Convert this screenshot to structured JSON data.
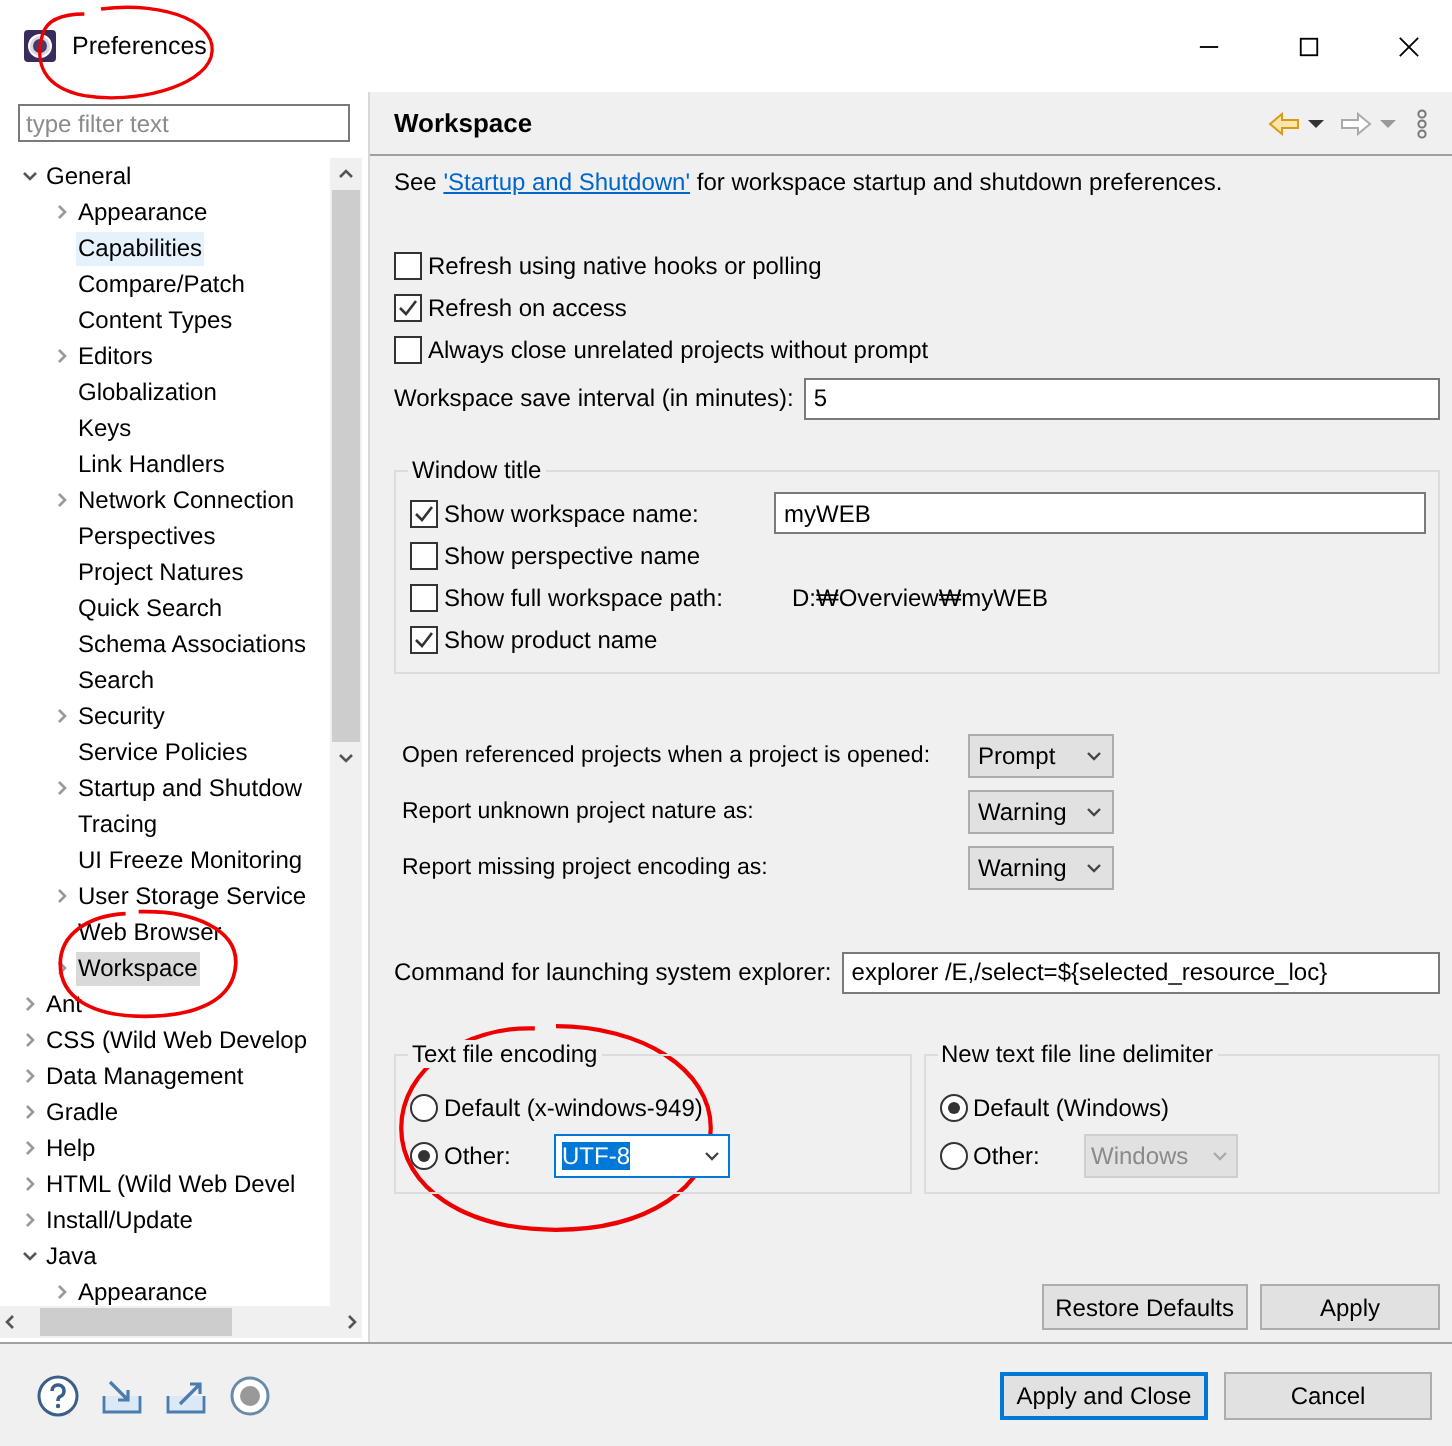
{
  "window": {
    "title": "Preferences"
  },
  "filter": {
    "placeholder": "type filter text"
  },
  "tree": [
    {
      "label": "General",
      "expanded": true,
      "selected": false,
      "children": [
        {
          "label": "Appearance",
          "expanded": false,
          "selected": false
        },
        {
          "label": "Capabilities",
          "selected": false,
          "highlighted": true
        },
        {
          "label": "Compare/Patch",
          "selected": false
        },
        {
          "label": "Content Types",
          "selected": false
        },
        {
          "label": "Editors",
          "expanded": false,
          "selected": false
        },
        {
          "label": "Globalization",
          "selected": false
        },
        {
          "label": "Keys",
          "selected": false
        },
        {
          "label": "Link Handlers",
          "selected": false
        },
        {
          "label": "Network Connection",
          "expanded": false,
          "selected": false
        },
        {
          "label": "Perspectives",
          "selected": false
        },
        {
          "label": "Project Natures",
          "selected": false
        },
        {
          "label": "Quick Search",
          "selected": false
        },
        {
          "label": "Schema Associations",
          "selected": false
        },
        {
          "label": "Search",
          "selected": false
        },
        {
          "label": "Security",
          "expanded": false,
          "selected": false
        },
        {
          "label": "Service Policies",
          "selected": false
        },
        {
          "label": "Startup and Shutdow",
          "expanded": false,
          "selected": false
        },
        {
          "label": "Tracing",
          "selected": false
        },
        {
          "label": "UI Freeze Monitoring",
          "selected": false
        },
        {
          "label": "User Storage Service",
          "expanded": false,
          "selected": false
        },
        {
          "label": "Web Browser",
          "selected": false
        },
        {
          "label": "Workspace",
          "expanded": false,
          "selected": true
        }
      ]
    },
    {
      "label": "Ant",
      "expanded": false,
      "selected": false
    },
    {
      "label": "CSS (Wild Web Develop",
      "expanded": false,
      "selected": false
    },
    {
      "label": "Data Management",
      "expanded": false,
      "selected": false
    },
    {
      "label": "Gradle",
      "expanded": false,
      "selected": false
    },
    {
      "label": "Help",
      "expanded": false,
      "selected": false
    },
    {
      "label": "HTML (Wild Web Devel",
      "expanded": false,
      "selected": false
    },
    {
      "label": "Install/Update",
      "expanded": false,
      "selected": false
    },
    {
      "label": "Java",
      "expanded": true,
      "selected": false,
      "children": [
        {
          "label": "Appearance",
          "expanded": false,
          "selected": false
        }
      ]
    }
  ],
  "page": {
    "title": "Workspace",
    "intro": {
      "before": "See ",
      "link": "'Startup and Shutdown'",
      "after": " for workspace startup and shutdown preferences."
    },
    "options": [
      {
        "label": "Refresh using native hooks or polling",
        "checked": false
      },
      {
        "label": "Refresh on access",
        "checked": true
      },
      {
        "label": "Always close unrelated projects without prompt",
        "checked": false
      }
    ],
    "save_interval": {
      "label": "Workspace save interval (in minutes):",
      "value": "5"
    },
    "window_title": {
      "legend": "Window title",
      "options": [
        {
          "kind": "field",
          "label": "Show workspace name:",
          "checked": true,
          "value": "myWEB"
        },
        {
          "kind": "plain",
          "label": "Show perspective name",
          "checked": false
        },
        {
          "kind": "path",
          "label": "Show full workspace path:",
          "checked": false,
          "value": "D:₩Overview₩myWEB"
        },
        {
          "kind": "plain",
          "label": "Show product name",
          "checked": true
        }
      ]
    },
    "selects": [
      {
        "label": "Open referenced projects when a project is opened:",
        "value": "Prompt"
      },
      {
        "label": "Report unknown project nature as:",
        "value": "Warning"
      },
      {
        "label": "Report missing project encoding as:",
        "value": "Warning"
      }
    ],
    "explorer": {
      "label": "Command for launching system explorer:",
      "value": "explorer /E,/select=${selected_resource_loc}"
    },
    "groups": [
      {
        "legend": "Text file encoding",
        "options": [
          {
            "label": "Default (x-windows-949)",
            "selected": false
          },
          {
            "label": "Other:",
            "selected": true
          }
        ],
        "combo": {
          "value": "UTF-8",
          "disabled": false,
          "text_selected": true
        }
      },
      {
        "legend": "New text file line delimiter",
        "options": [
          {
            "label": "Default (Windows)",
            "selected": true
          },
          {
            "label": "Other:",
            "selected": false
          }
        ],
        "combo": {
          "value": "Windows",
          "disabled": true,
          "text_selected": false
        }
      }
    ],
    "buttons": [
      "Restore Defaults",
      "Apply"
    ]
  },
  "footer": {
    "buttons": [
      {
        "label": "Apply and Close",
        "default": true
      },
      {
        "label": "Cancel",
        "default": false
      }
    ]
  }
}
